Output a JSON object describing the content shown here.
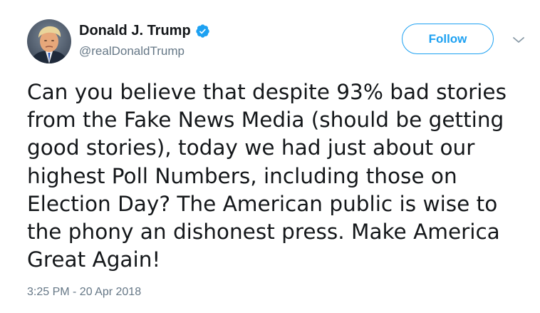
{
  "tweet": {
    "author": {
      "display_name": "Donald J. Trump",
      "handle": "@realDonaldTrump",
      "verified": true,
      "avatar": "profile-photo"
    },
    "follow_label": "Follow",
    "menu_icon": "chevron-down-icon",
    "text": "Can you believe that despite 93% bad stories from the Fake News Media (should be getting good stories), today we had just about our highest Poll Numbers, including those on Election Day? The American public is wise to the phony an dishonest press. Make America Great Again!",
    "timestamp": "3:25 PM - 20 Apr 2018"
  },
  "colors": {
    "accent": "#1da1f2",
    "text": "#14171a",
    "secondary_text": "#657786",
    "background": "#ffffff"
  }
}
